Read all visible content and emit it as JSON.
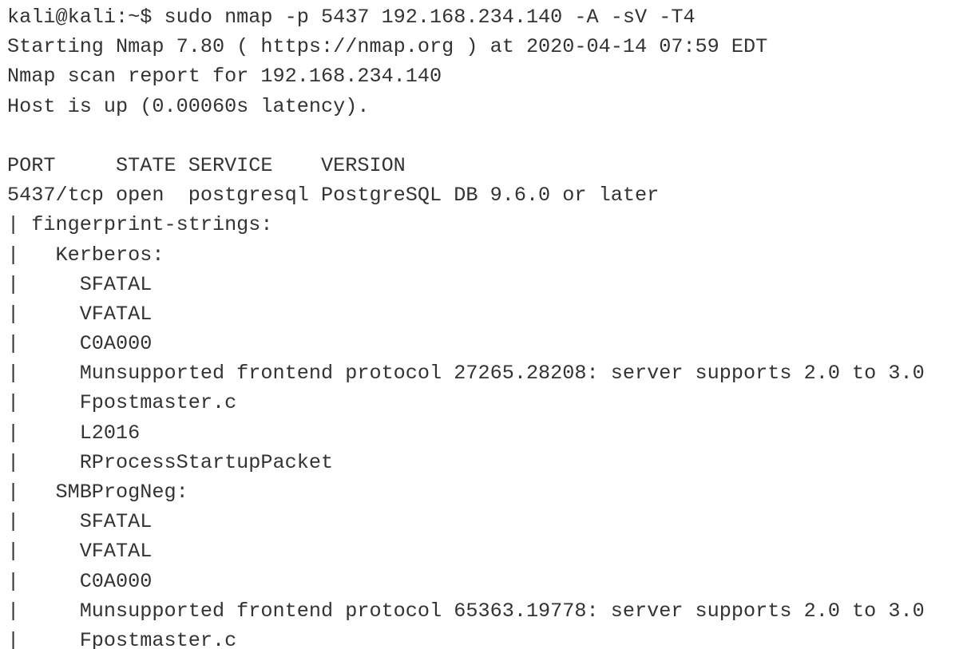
{
  "terminal": {
    "lines": [
      "kali@kali:~$ sudo nmap -p 5437 192.168.234.140 -A -sV -T4",
      "Starting Nmap 7.80 ( https://nmap.org ) at 2020-04-14 07:59 EDT",
      "Nmap scan report for 192.168.234.140",
      "Host is up (0.00060s latency).",
      "",
      "PORT     STATE SERVICE    VERSION",
      "5437/tcp open  postgresql PostgreSQL DB 9.6.0 or later",
      "| fingerprint-strings:",
      "|   Kerberos:",
      "|     SFATAL",
      "|     VFATAL",
      "|     C0A000",
      "|     Munsupported frontend protocol 27265.28208: server supports 2.0 to 3.0",
      "|     Fpostmaster.c",
      "|     L2016",
      "|     RProcessStartupPacket",
      "|   SMBProgNeg:",
      "|     SFATAL",
      "|     VFATAL",
      "|     C0A000",
      "|     Munsupported frontend protocol 65363.19778: server supports 2.0 to 3.0",
      "|     Fpostmaster.c"
    ]
  }
}
